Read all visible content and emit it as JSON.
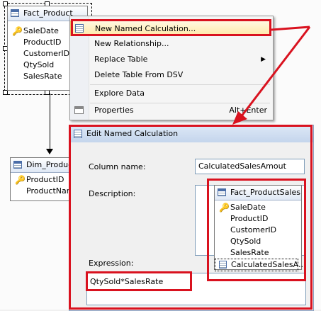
{
  "diagram": {
    "fact_table": {
      "title": "Fact_Product",
      "columns": [
        "SaleDate",
        "ProductID",
        "CustomerID",
        "QtySold",
        "SalesRate"
      ],
      "key_column_index": 0
    },
    "dim_table": {
      "title": "Dim_Product",
      "columns": [
        "ProductID",
        "ProductNam"
      ],
      "key_column_index": 0
    }
  },
  "context_menu": {
    "items": [
      {
        "label": "New Named Calculation...",
        "highlighted": true
      },
      {
        "label": "New Relationship..."
      },
      {
        "label": "Replace Table",
        "submenu": true
      },
      {
        "label": "Delete Table From DSV"
      },
      {
        "label": "Explore Data"
      },
      {
        "label": "Properties",
        "shortcut": "Alt+Enter"
      }
    ]
  },
  "dialog": {
    "title": "Edit Named Calculation",
    "column_name_label": "Column name:",
    "column_name_value": "CalculatedSalesAmout",
    "description_label": "Description:",
    "expression_label": "Expression:",
    "expression_value": "QtySold*SalesRate",
    "preview_table": {
      "title": "Fact_ProductSales",
      "columns": [
        "SaleDate",
        "ProductID",
        "CustomerID",
        "QtySold",
        "SalesRate",
        "CalculatedSalesA..."
      ],
      "key_column_index": 0,
      "calculated_column_index": 5
    }
  },
  "colors": {
    "annotation_red": "#d9121f",
    "menu_highlight": "#ffe9a8"
  }
}
